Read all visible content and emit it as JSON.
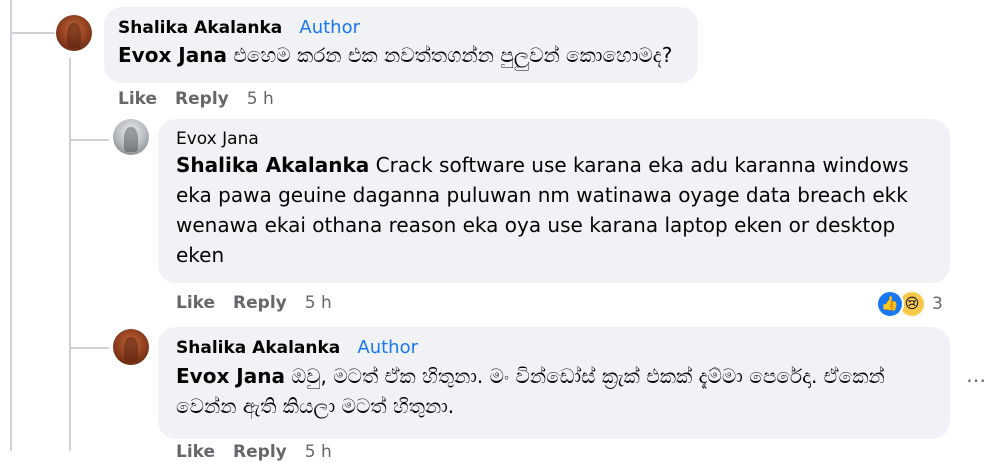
{
  "comments": [
    {
      "author": "Shalika Akalanka",
      "badge": "Author",
      "mention": "Evox Jana",
      "text": " එහෙම කරන එක නවත්තගන්න පුලුවන් කොහොමද?",
      "actions": {
        "like": "Like",
        "reply": "Reply",
        "time": "5 h"
      }
    },
    {
      "author": "Evox Jana",
      "mention": "Shalika Akalanka",
      "text": " Crack software use karana eka adu karanna windows eka pawa geuine daganna puluwan nm watinawa oyage data breach ekk wenawa ekai othana reason eka oya use karana laptop eken or desktop eken",
      "actions": {
        "like": "Like",
        "reply": "Reply",
        "time": "5 h"
      },
      "reactions": {
        "icons": [
          "like-icon",
          "sad-icon"
        ],
        "count": "3"
      }
    },
    {
      "author": "Shalika Akalanka",
      "badge": "Author",
      "mention": "Evox Jana",
      "line1": " ඔවු, මටත් ඒක හිතුනා. මං වින්ඩෝස් ක්‍රැක් එකක් දැම්මා පෙරේදා. ඒකෙන්",
      "line2": "වෙන්න ඇති කියලා මටත් හිතුනා.",
      "actions": {
        "like": "Like",
        "reply": "Reply",
        "time": "5 h"
      }
    }
  ],
  "colors": {
    "bubble": "#f0f2f5",
    "author_badge": "#1877f2",
    "meta": "#65676b",
    "thread_line": "#cfd2d6"
  }
}
